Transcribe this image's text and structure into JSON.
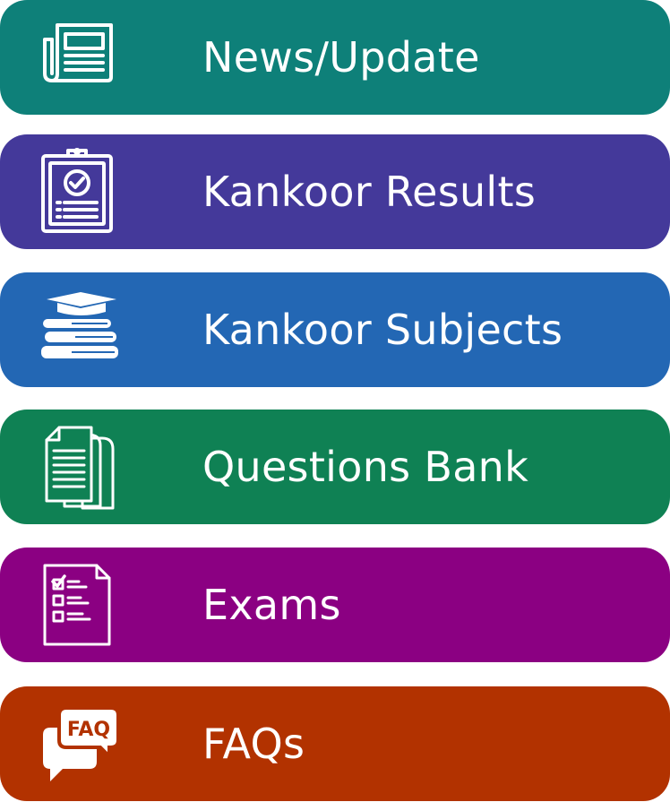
{
  "menu": {
    "items": [
      {
        "label": "News/Update",
        "icon": "newspaper-icon",
        "color": "#0e8079"
      },
      {
        "label": "Kankoor Results",
        "icon": "clipboard-check-icon",
        "color": "#44399a"
      },
      {
        "label": "Kankoor Subjects",
        "icon": "graduation-books-icon",
        "color": "#2367b4"
      },
      {
        "label": "Questions Bank",
        "icon": "documents-stack-icon",
        "color": "#0f8154"
      },
      {
        "label": "Exams",
        "icon": "exam-checklist-icon",
        "color": "#8b0082"
      },
      {
        "label": "FAQs",
        "icon": "faq-bubbles-icon",
        "color": "#b23200"
      }
    ]
  }
}
